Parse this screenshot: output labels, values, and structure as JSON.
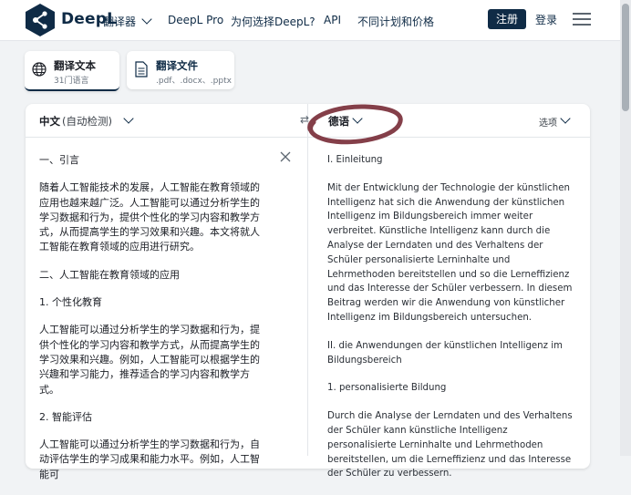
{
  "header": {
    "logo_text": "DeepL",
    "logo_sub": "翻译器",
    "nav": [
      "DeepL Pro",
      "为何选择DeepL?",
      "API",
      "不同计划和价格"
    ],
    "register": "注册",
    "login": "登录"
  },
  "modes": [
    {
      "title": "翻译文本",
      "sub": "31门语言",
      "icon": "globe-icon"
    },
    {
      "title": "翻译文件",
      "sub": ".pdf、.docx、.pptx",
      "icon": "document-icon"
    }
  ],
  "source": {
    "language": "中文",
    "detect": "(自动检测)",
    "paragraphs": [
      "一、引言",
      "随着人工智能技术的发展，人工智能在教育领域的应用也越来越广泛。人工智能可以通过分析学生的学习数据和行为，提供个性化的学习内容和教学方式，从而提高学生的学习效果和兴趣。本文将就人工智能在教育领域的应用进行研究。",
      "二、人工智能在教育领域的应用",
      "1. 个性化教育",
      "人工智能可以通过分析学生的学习数据和行为，提供个性化的学习内容和教学方式，从而提高学生的学习效果和兴趣。例如，人工智能可以根据学生的兴趣和学习能力，推荐适合的学习内容和教学方式。",
      "2. 智能评估",
      "人工智能可以通过分析学生的学习数据和行为，自动评估学生的学习成果和能力水平。例如，人工智能可"
    ]
  },
  "target": {
    "language": "德语",
    "options": "选项",
    "paragraphs": [
      "I. Einleitung",
      "Mit der Entwicklung der Technologie der künstlichen Intelligenz hat sich die Anwendung der künstlichen Intelligenz im Bildungsbereich immer weiter verbreitet. Künstliche Intelligenz kann durch die Analyse der Lerndaten und des Verhaltens der Schüler personalisierte Lerninhalte und Lehrmethoden bereitstellen und so die Lerneffizienz und das Interesse der Schüler verbessern. In diesem Beitrag werden wir die Anwendung von künstlicher Intelligenz im Bildungsbereich untersuchen.",
      "II. die Anwendungen der künstlichen Intelligenz im Bildungsbereich",
      "1. personalisierte Bildung",
      "Durch die Analyse der Lerndaten und des Verhaltens der Schüler kann künstliche Intelligenz personalisierte Lerninhalte und Lehrmethoden bereitstellen, um die Lerneffizienz und das Interesse der Schüler zu verbessern."
    ]
  },
  "colors": {
    "brand": "#0f2b46",
    "annotation": "#7a2f3a"
  }
}
